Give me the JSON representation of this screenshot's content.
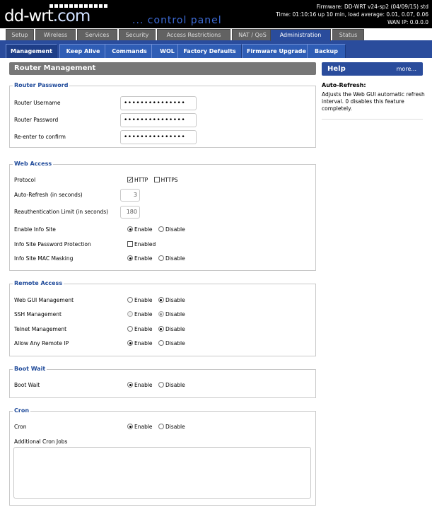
{
  "header": {
    "logo_main": "dd-wrt",
    "logo_suffix": ".com",
    "control_panel": "... control panel",
    "firmware": "Firmware: DD-WRT v24-sp2 (04/09/15) std",
    "time": "Time: 01:10:16 up 10 min, load average: 0.01, 0.07, 0.06",
    "wan_ip": "WAN IP: 0.0.0.0"
  },
  "main_tabs": [
    {
      "label": "Setup",
      "active": false
    },
    {
      "label": "Wireless",
      "active": false
    },
    {
      "label": "Services",
      "active": false
    },
    {
      "label": "Security",
      "active": false
    },
    {
      "label": "Access Restrictions",
      "active": false
    },
    {
      "label": "NAT / QoS",
      "active": false
    },
    {
      "label": "Administration",
      "active": true
    },
    {
      "label": "Status",
      "active": false
    }
  ],
  "sub_tabs": [
    {
      "label": "Management",
      "active": true
    },
    {
      "label": "Keep Alive",
      "active": false
    },
    {
      "label": "Commands",
      "active": false
    },
    {
      "label": "WOL",
      "active": false
    },
    {
      "label": "Factory Defaults",
      "active": false
    },
    {
      "label": "Firmware Upgrade",
      "active": false
    },
    {
      "label": "Backup",
      "active": false
    }
  ],
  "page_title": "Router Management",
  "router_password": {
    "legend": "Router Password",
    "username_label": "Router Username",
    "username_value": "•••••••••••••••",
    "password_label": "Router Password",
    "password_value": "•••••••••••••••",
    "confirm_label": "Re-enter to confirm",
    "confirm_value": "•••••••••••••••"
  },
  "web_access": {
    "legend": "Web Access",
    "protocol_label": "Protocol",
    "http_label": "HTTP",
    "http_checked": true,
    "https_label": "HTTPS",
    "https_checked": false,
    "refresh_label": "Auto-Refresh (in seconds)",
    "refresh_value": "3",
    "reauth_label": "Reauthentication Limit (in seconds)",
    "reauth_value": "180",
    "info_site_label": "Enable Info Site",
    "info_pw_label": "Info Site Password Protection",
    "info_pw_option": "Enabled",
    "info_mac_label": "Info Site MAC Masking"
  },
  "remote_access": {
    "legend": "Remote Access",
    "webgui_label": "Web GUI Management",
    "ssh_label": "SSH Management",
    "telnet_label": "Telnet Management",
    "anyip_label": "Allow Any Remote IP"
  },
  "boot_wait": {
    "legend": "Boot Wait",
    "label": "Boot Wait"
  },
  "cron": {
    "legend": "Cron",
    "label": "Cron",
    "jobs_label": "Additional Cron Jobs"
  },
  "options": {
    "enable": "Enable",
    "disable": "Disable"
  },
  "help": {
    "title": "Help",
    "more": "more...",
    "heading": "Auto-Refresh:",
    "body": "Adjusts the Web GUI automatic refresh interval. 0 disables this feature completely."
  }
}
